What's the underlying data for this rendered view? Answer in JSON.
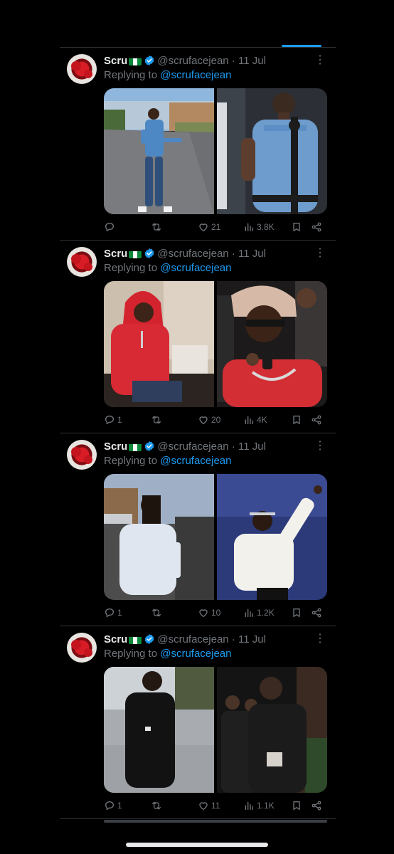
{
  "colors": {
    "background": "#000000",
    "accent": "#1d9bf0",
    "text": "#e7e9ea",
    "muted": "#71767b",
    "divider": "#2f3336"
  },
  "tweets": [
    {
      "name": "Scru",
      "flag": "nigeria-flag-icon",
      "handle": "@scrufacejean",
      "dot": "·",
      "time": "11 Jul",
      "reply_prefix": "Replying to ",
      "reply_handle": "@scrufacejean",
      "images": [
        "person-in-blue-shirt-on-street-photo",
        "performer-in-blue-shirt-with-microphone-photo"
      ],
      "replies": "",
      "retweets": "",
      "likes": "21",
      "views": "3.8K"
    },
    {
      "name": "Scru",
      "flag": "nigeria-flag-icon",
      "handle": "@scrufacejean",
      "dot": "·",
      "time": "11 Jul",
      "reply_prefix": "Replying to ",
      "reply_handle": "@scrufacejean",
      "images": [
        "person-in-red-hoodie-crouching-photo",
        "performer-in-red-hoodie-with-microphone-photo"
      ],
      "replies": "1",
      "retweets": "",
      "likes": "20",
      "views": "4K"
    },
    {
      "name": "Scru",
      "flag": "nigeria-flag-icon",
      "handle": "@scrufacejean",
      "dot": "·",
      "time": "11 Jul",
      "reply_prefix": "Replying to ",
      "reply_handle": "@scrufacejean",
      "images": [
        "person-in-white-shirt-outdoors-photo",
        "performer-in-white-shirt-raising-arm-photo"
      ],
      "replies": "1",
      "retweets": "",
      "likes": "10",
      "views": "1.2K"
    },
    {
      "name": "Scru",
      "flag": "nigeria-flag-icon",
      "handle": "@scrufacejean",
      "dot": "·",
      "time": "11 Jul",
      "reply_prefix": "Replying to ",
      "reply_handle": "@scrufacejean",
      "images": [
        "person-in-black-outfit-on-street-photo",
        "man-in-black-outfit-with-group-photo"
      ],
      "replies": "1",
      "retweets": "",
      "likes": "11",
      "views": "1.1K"
    }
  ]
}
